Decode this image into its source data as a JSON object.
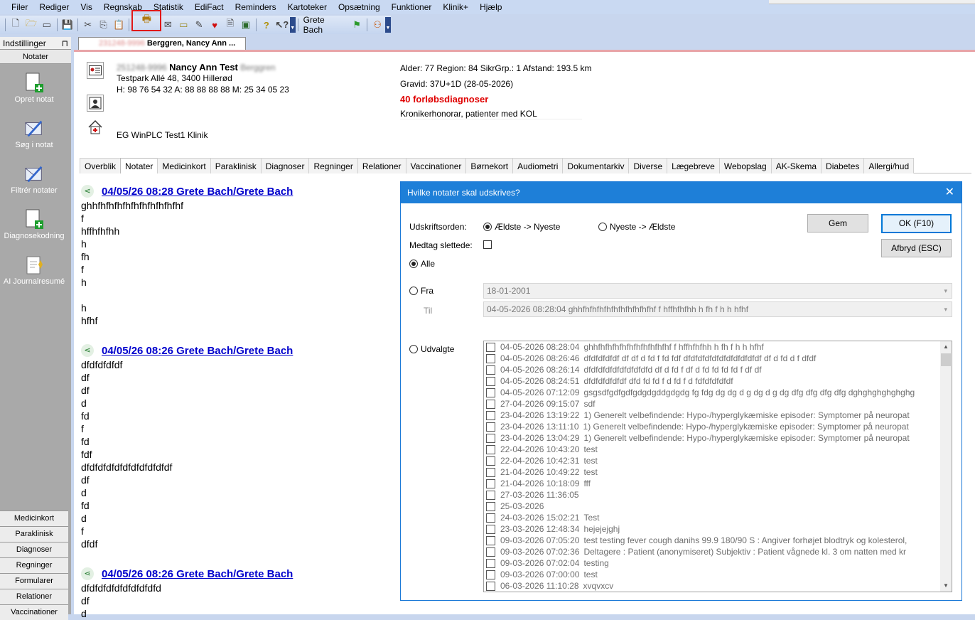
{
  "menu": [
    "Filer",
    "Rediger",
    "Vis",
    "Regnskab",
    "Statistik",
    "EdiFact",
    "Reminders",
    "Kartoteker",
    "Opsætning",
    "Funktioner",
    "Klinik+",
    "Hjælp"
  ],
  "toolbar": {
    "user_label": "Grete Bach"
  },
  "left_panel": {
    "header": "Indstillinger",
    "pin": "⊓",
    "section": "Notater",
    "tools": [
      "Opret notat",
      "Søg i notat",
      "Filtrér notater",
      "Diagnosekodning",
      "AI Journalresumé"
    ],
    "bottom": [
      "Medicinkort",
      "Paraklinisk",
      "Diagnoser",
      "Regninger",
      "Formularer",
      "Relationer",
      "Vaccinationer"
    ]
  },
  "doc_tab": {
    "id": "231248-9996",
    "name": "Berggren, Nancy Ann ..."
  },
  "patient": {
    "cpr": "251248-9996",
    "name": "Nancy Ann Test",
    "surname_hidden": "Berggren",
    "address": "Testpark Allé 48, 3400 Hillerød",
    "phones": "H: 98 76 54 32 A: 88 88 88 88 M: 25 34 05 23",
    "clinic": "EG WinPLC Test1 Klinik",
    "info1": "Alder: 77   Region: 84   SikrGrp.: 1   Afstand: 193.5 km",
    "info2": "Gravid: 37U+1D (28-05-2026)",
    "diagnoses": "40 forløbsdiagnoser",
    "honorar": "Kronikerhonorar, patienter med KOL"
  },
  "tabs": [
    "Overblik",
    "Notater",
    "Medicinkort",
    "Paraklinisk",
    "Diagnoser",
    "Regninger",
    "Relationer",
    "Vaccinationer",
    "Børnekort",
    "Audiometri",
    "Dokumentarkiv",
    "Diverse",
    "Lægebreve",
    "Webopslag",
    "AK-Skema",
    "Diabetes",
    "Allergi/hud"
  ],
  "notes": [
    {
      "header": "04/05/26 08:28   Grete Bach/Grete Bach",
      "body": "ghhfhfhfhfhfhfhfhfhfhfhf\nf\nhffhfhfhh\nh\nfh\nf\nh\n\nh\nhfhf"
    },
    {
      "header": "04/05/26 08:26   Grete Bach/Grete Bach",
      "body": "dfdfdfdfdf\ndf\ndf\nd\nfd\nf\nfd\nfdf\ndfdfdfdfdfdfdfdfdfdfdf\ndf\nd\nfd\nd\nf\ndfdf"
    },
    {
      "header": "04/05/26 08:26   Grete Bach/Grete Bach",
      "body": "dfdfdfdfdfdfdfdfdfd\ndf\nd"
    }
  ],
  "dialog": {
    "title": "Hvilke notater skal udskrives?",
    "close": "✕",
    "order_label": "Udskriftsorden:",
    "order_opt1": "Ældste -> Nyeste",
    "order_opt2": "Nyeste -> Ældste",
    "include_deleted": "Medtag slettede:",
    "all": "Alle",
    "from": "Fra",
    "to": "Til",
    "selected": "Udvalgte",
    "from_value": "18-01-2001",
    "to_value": "04-05-2026 08:28:04  ghhfhfhfhfhfhfhfhfhfhfhf f hffhfhfhh h fh f h h hfhf",
    "save": "Gem",
    "ok": "OK (F10)",
    "cancel": "Afbryd (ESC)",
    "items": [
      {
        "date": "04-05-2026 08:28:04",
        "text": "ghhfhfhfhfhfhfhfhfhfhfhf f hffhfhfhh h fh f h h hfhf"
      },
      {
        "date": "04-05-2026 08:26:46",
        "text": "dfdfdfdfdf df df d fd f fd fdf dfdfdfdfdfdfdfdfdfdfdf df d fd d f dfdf"
      },
      {
        "date": "04-05-2026 08:26:14",
        "text": "dfdfdfdfdfdfdfdfdfd df d fd f df d fd fd fd fd f df df"
      },
      {
        "date": "04-05-2026 08:24:51",
        "text": "dfdfdfdfdfdf dfd fd fd f d fd f d fdfdfdfdfdf"
      },
      {
        "date": "04-05-2026 07:12:09",
        "text": "gsgsdfgdfgdfgdgdgddgdgdg fg fdg dg dg d g dg d g dg dfg dfg dfg dfg dghghghghghghg"
      },
      {
        "date": "27-04-2026 09:15:07",
        "text": "sdf"
      },
      {
        "date": "23-04-2026 13:19:22",
        "text": "1) Generelt velbefindende: Hypo-/hyperglykæmiske episoder: Symptomer på neuropat"
      },
      {
        "date": "23-04-2026 13:11:10",
        "text": "1) Generelt velbefindende: Hypo-/hyperglykæmiske episoder: Symptomer på neuropat"
      },
      {
        "date": "23-04-2026 13:04:29",
        "text": "1) Generelt velbefindende: Hypo-/hyperglykæmiske episoder: Symptomer på neuropat"
      },
      {
        "date": "22-04-2026 10:43:20",
        "text": "test"
      },
      {
        "date": "22-04-2026 10:42:31",
        "text": "test"
      },
      {
        "date": "21-04-2026 10:49:22",
        "text": "test"
      },
      {
        "date": "21-04-2026 10:18:09",
        "text": "fff"
      },
      {
        "date": "27-03-2026 11:36:05",
        "text": ""
      },
      {
        "date": "25-03-2026",
        "text": ""
      },
      {
        "date": "24-03-2026 15:02:21",
        "text": "Test"
      },
      {
        "date": "23-03-2026 12:48:34",
        "text": "hejejejghj"
      },
      {
        "date": "09-03-2026 07:05:20",
        "text": "test testing fever cough danihs 99.9 180/90 S : Angiver forhøjet blodtryk og kolesterol,"
      },
      {
        "date": "09-03-2026 07:02:36",
        "text": "Deltagere : Patient (anonymiseret) Subjektiv : Patient vågnede kl. 3 om natten med kr"
      },
      {
        "date": "09-03-2026 07:02:04",
        "text": "testing"
      },
      {
        "date": "09-03-2026 07:00:00",
        "text": "test"
      },
      {
        "date": "06-03-2026 11:10:28",
        "text": "xvqvxcv"
      }
    ]
  }
}
